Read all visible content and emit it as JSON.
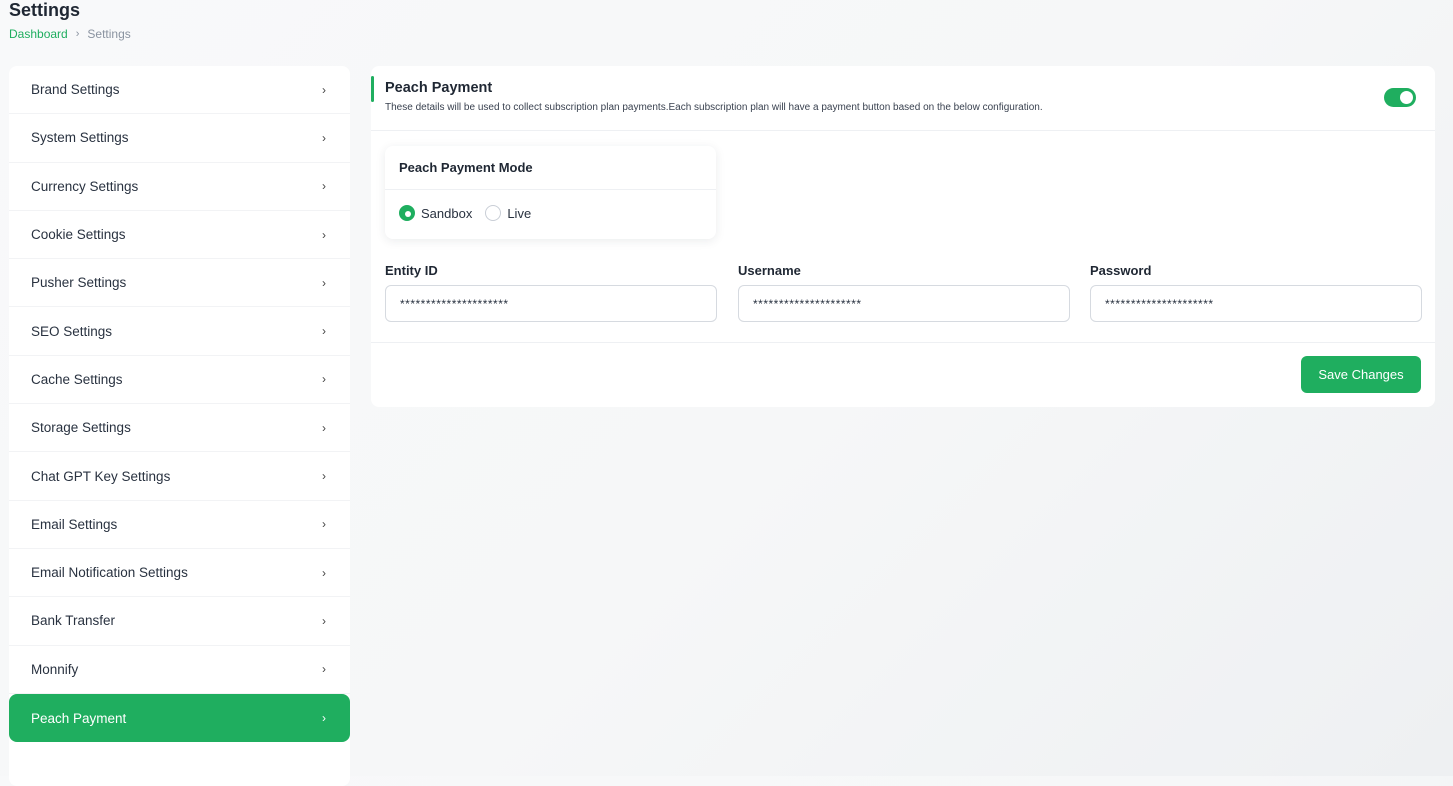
{
  "page": {
    "title": "Settings",
    "breadcrumb": {
      "home": "Dashboard",
      "separator": "›",
      "current": "Settings"
    }
  },
  "sidebar": {
    "chevron": "›",
    "items": [
      {
        "label": "Brand Settings",
        "active": false
      },
      {
        "label": "System Settings",
        "active": false
      },
      {
        "label": "Currency Settings",
        "active": false
      },
      {
        "label": "Cookie Settings",
        "active": false
      },
      {
        "label": "Pusher Settings",
        "active": false
      },
      {
        "label": "SEO Settings",
        "active": false
      },
      {
        "label": "Cache Settings",
        "active": false
      },
      {
        "label": "Storage Settings",
        "active": false
      },
      {
        "label": "Chat GPT Key Settings",
        "active": false
      },
      {
        "label": "Email Settings",
        "active": false
      },
      {
        "label": "Email Notification Settings",
        "active": false
      },
      {
        "label": "Bank Transfer",
        "active": false
      },
      {
        "label": "Monnify",
        "active": false
      },
      {
        "label": "Peach Payment",
        "active": true
      }
    ]
  },
  "card": {
    "title": "Peach Payment",
    "description": "These details will be used to collect subscription plan payments.Each subscription plan will have a payment button based on the below configuration.",
    "enabled": true,
    "mode": {
      "title": "Peach Payment Mode",
      "options": [
        {
          "label": "Sandbox",
          "checked": true
        },
        {
          "label": "Live",
          "checked": false
        }
      ]
    },
    "fields": {
      "entity_id": {
        "label": "Entity ID",
        "value": "*********************"
      },
      "username": {
        "label": "Username",
        "value": "*********************"
      },
      "password": {
        "label": "Password",
        "value": "*********************"
      }
    },
    "save_label": "Save Changes"
  },
  "colors": {
    "accent": "#1fae5f",
    "text": "#293240",
    "background": "#f7f8f9"
  }
}
